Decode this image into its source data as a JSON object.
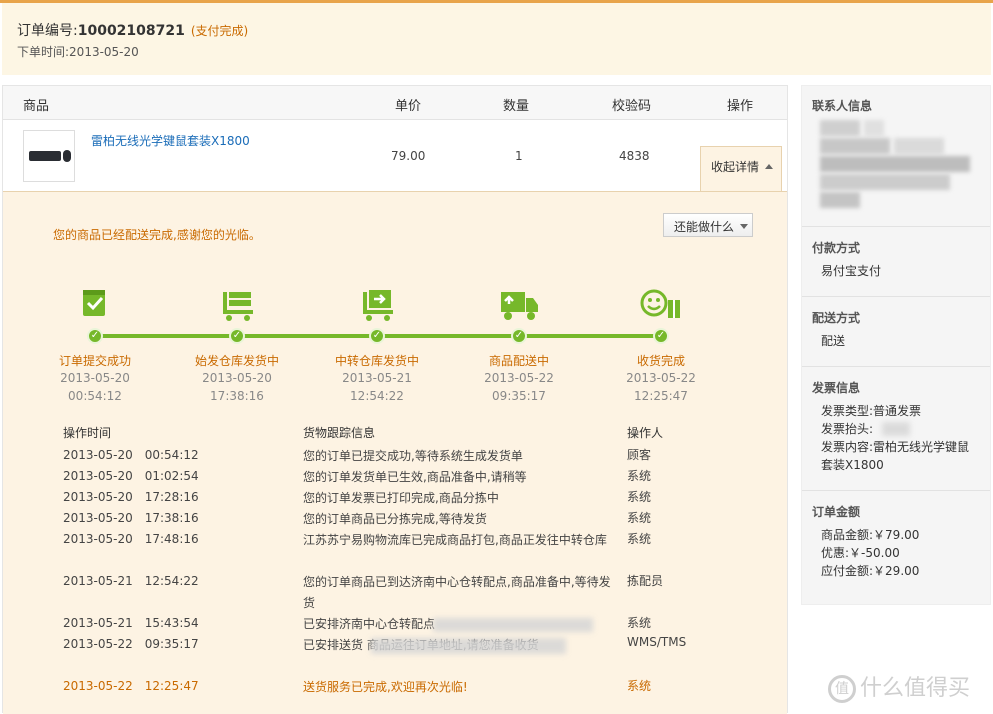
{
  "order": {
    "number_label": "订单编号:",
    "number": "10002108721",
    "status": "(支付完成)",
    "time_label": "下单时间:",
    "time": "2013-05-20"
  },
  "table": {
    "headers": {
      "product": "商品",
      "price": "单价",
      "qty": "数量",
      "code": "校验码",
      "action": "操作"
    },
    "product": {
      "name": "雷柏无线光学键鼠套装X1800",
      "price": "79.00",
      "qty": "1",
      "code": "4838"
    },
    "collapse_label": "收起详情"
  },
  "detail": {
    "delivered_msg": "您的商品已经配送完成,感谢您的光临。",
    "more_label": "还能做什么",
    "steps": [
      {
        "label": "订单提交成功",
        "date": "2013-05-20",
        "time": "00:54:12",
        "icon": "order-icon"
      },
      {
        "label": "始发仓库发货中",
        "date": "2013-05-20",
        "time": "17:38:16",
        "icon": "warehouse-cart-icon"
      },
      {
        "label": "中转仓库发货中",
        "date": "2013-05-21",
        "time": "12:54:22",
        "icon": "transfer-cart-icon"
      },
      {
        "label": "商品配送中",
        "date": "2013-05-22",
        "time": "09:35:17",
        "icon": "truck-icon"
      },
      {
        "label": "收货完成",
        "date": "2013-05-22",
        "time": "12:25:47",
        "icon": "smile-gift-icon"
      }
    ],
    "log_headers": {
      "time": "操作时间",
      "info": "货物跟踪信息",
      "operator": "操作人"
    },
    "logs": [
      {
        "time": "2013-05-20　00:54:12",
        "info": "您的订单已提交成功,等待系统生成发货单",
        "operator": "顾客"
      },
      {
        "time": "2013-05-20　01:02:54",
        "info": "您的订单发货单已生效,商品准备中,请稍等",
        "operator": "系统"
      },
      {
        "time": "2013-05-20　17:28:16",
        "info": "您的订单发票已打印完成,商品分拣中",
        "operator": "系统"
      },
      {
        "time": "2013-05-20　17:38:16",
        "info": "您的订单商品已分拣完成,等待发货",
        "operator": "系统"
      },
      {
        "time": "2013-05-20　17:48:16",
        "info": "江苏苏宁易购物流库已完成商品打包,商品正发往中转仓库",
        "operator": "系统"
      },
      {
        "time": "2013-05-21　12:54:22",
        "info": "您的订单商品已到达济南中心仓转配点,商品准备中,等待发货",
        "operator": "拣配员"
      },
      {
        "time": "2013-05-21　15:43:54",
        "info": "已安排济南中心仓转配点",
        "operator": "系统"
      },
      {
        "time": "2013-05-22　09:35:17",
        "info": "已安排送货                                    商品运往订单地址,请您准备收货",
        "operator": "WMS/TMS"
      },
      {
        "time": "2013-05-22　12:25:47",
        "info": "送货服务已完成,欢迎再次光临!",
        "operator": "系统"
      }
    ]
  },
  "sidebar": {
    "contact_title": "联系人信息",
    "payment_title": "付款方式",
    "payment_value": "易付宝支付",
    "delivery_title": "配送方式",
    "delivery_value": "配送",
    "invoice_title": "发票信息",
    "invoice_type": "发票类型:普通发票",
    "invoice_head": "发票抬头:",
    "invoice_content_1": "发票内容:雷柏无线光学键鼠",
    "invoice_content_2": "套装X1800",
    "amount_title": "订单金额",
    "goods_amount": "商品金额:￥79.00",
    "discount": "优惠:￥-50.00",
    "payable": "应付金额:￥29.00"
  },
  "watermark": {
    "text": "什么值得买",
    "logo": "值"
  },
  "colors": {
    "accent": "#c96a00",
    "green": "#76b82a",
    "link": "#1a6cb8",
    "header_bg": "#fdf6e4",
    "detail_bg": "#fdf3e3"
  }
}
